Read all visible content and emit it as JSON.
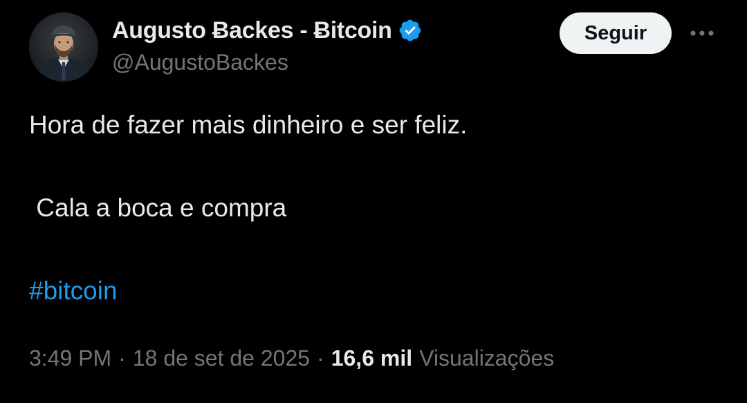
{
  "author": {
    "display_name": "Augusto Ƀackes - Ƀitcoin",
    "handle": "@AugustoBackes",
    "avatar_icon": "profile-photo",
    "verified_icon": "verified-badge-icon",
    "verified_color": "#1d9bf0"
  },
  "actions": {
    "follow_label": "Seguir",
    "more_icon": "more-horizontal-icon"
  },
  "tweet": {
    "line1": "Hora de fazer mais dinheiro e ser feliz.",
    "line2": " Cala a boca e compra",
    "hashtag": "#bitcoin"
  },
  "meta": {
    "time": "3:49 PM",
    "separator": "·",
    "date": "18 de set de 2025",
    "views_count": "16,6 mil",
    "views_label": "Visualizações"
  },
  "colors": {
    "background": "#000000",
    "text_primary": "#e7e9ea",
    "text_secondary": "#71767b",
    "link": "#1d9bf0",
    "button_bg": "#eff3f4"
  }
}
